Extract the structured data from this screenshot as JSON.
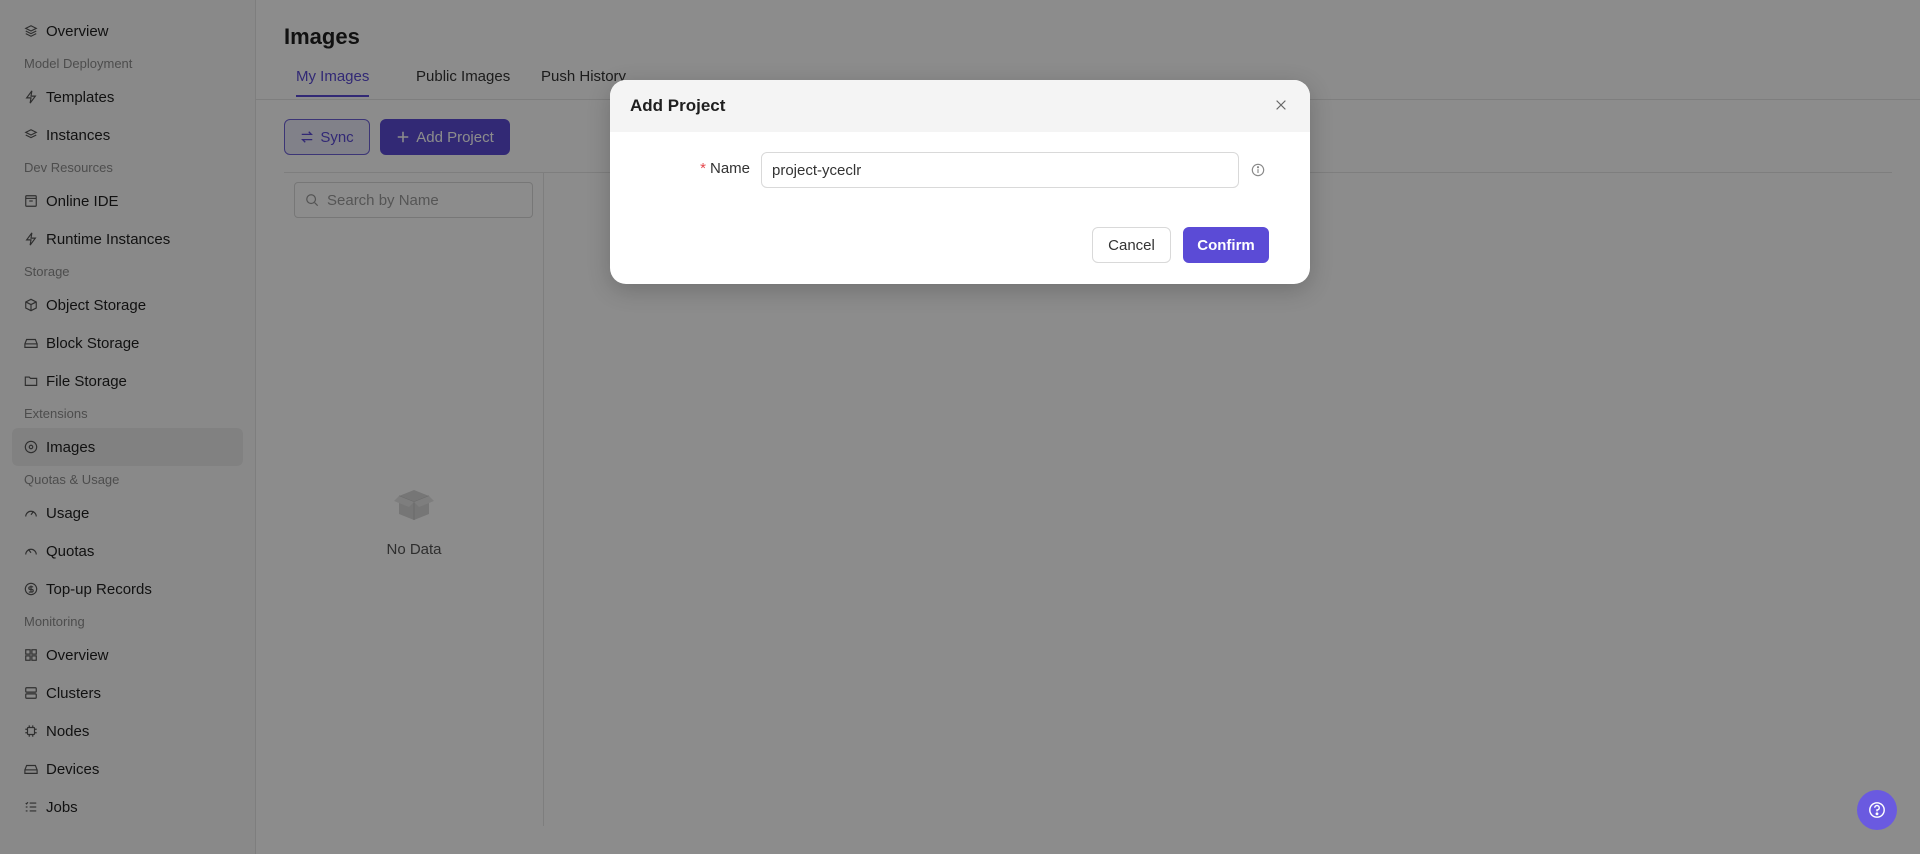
{
  "sidebar": {
    "overview": "Overview",
    "groups": [
      {
        "title": "Model Deployment",
        "items": [
          {
            "label": "Templates",
            "icon": "bolt-icon"
          },
          {
            "label": "Instances",
            "icon": "layers-icon"
          }
        ]
      },
      {
        "title": "Dev Resources",
        "items": [
          {
            "label": "Online IDE",
            "icon": "code-window-icon"
          },
          {
            "label": "Runtime Instances",
            "icon": "bolt-icon"
          }
        ]
      },
      {
        "title": "Storage",
        "items": [
          {
            "label": "Object Storage",
            "icon": "cube-icon"
          },
          {
            "label": "Block Storage",
            "icon": "drive-icon"
          },
          {
            "label": "File Storage",
            "icon": "folder-icon"
          }
        ]
      },
      {
        "title": "Extensions",
        "items": [
          {
            "label": "Images",
            "icon": "disc-icon",
            "active": true
          }
        ]
      },
      {
        "title": "Quotas & Usage",
        "items": [
          {
            "label": "Usage",
            "icon": "gauge-icon"
          },
          {
            "label": "Quotas",
            "icon": "gauge-icon"
          },
          {
            "label": "Top-up Records",
            "icon": "coin-icon"
          }
        ]
      },
      {
        "title": "Monitoring",
        "items": [
          {
            "label": "Overview",
            "icon": "grid-icon"
          },
          {
            "label": "Clusters",
            "icon": "server-icon"
          },
          {
            "label": "Nodes",
            "icon": "chip-icon"
          },
          {
            "label": "Devices",
            "icon": "drive-icon"
          },
          {
            "label": "Jobs",
            "icon": "list-icon"
          }
        ]
      }
    ]
  },
  "main": {
    "title": "Images",
    "tabs": [
      "My Images",
      "Public Images",
      "Push History"
    ],
    "sync_label": "Sync",
    "add_project_label": "Add Project",
    "search_placeholder": "Search by Name",
    "empty_text": "No Data"
  },
  "modal": {
    "title": "Add Project",
    "name_label": "Name",
    "name_value": "project-yceclr",
    "cancel_label": "Cancel",
    "confirm_label": "Confirm"
  },
  "colors": {
    "accent": "#5b4bd6",
    "help_button": "#6a5ae0",
    "required": "#e5484d"
  }
}
